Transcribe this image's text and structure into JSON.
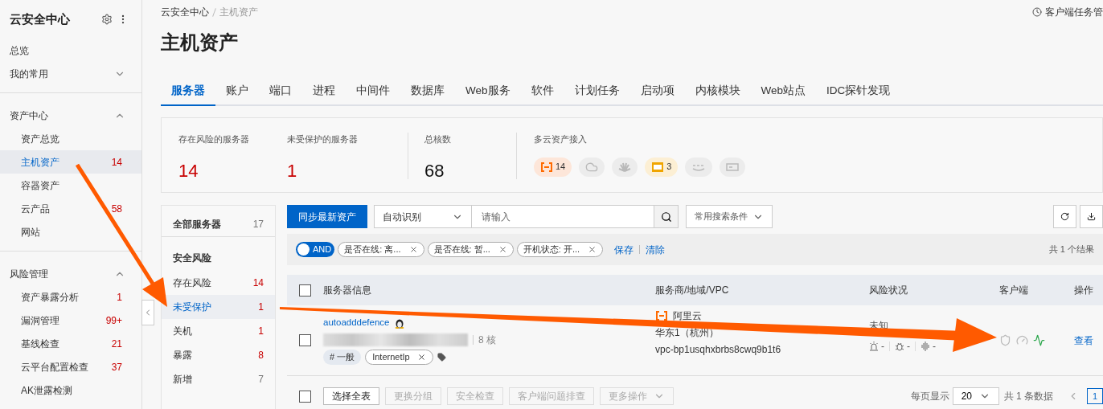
{
  "sidebar": {
    "title": "云安全中心",
    "groups": [
      {
        "label": "总览",
        "kind": "link"
      },
      {
        "label": "我的常用",
        "kind": "group",
        "expanded": false
      },
      {
        "label": "资产中心",
        "kind": "group",
        "expanded": true,
        "items": [
          {
            "label": "资产总览",
            "selected": false
          },
          {
            "label": "主机资产",
            "count": "14",
            "selected": true
          },
          {
            "label": "容器资产",
            "selected": false
          },
          {
            "label": "云产品",
            "count": "58",
            "selected": false
          },
          {
            "label": "网站",
            "selected": false
          }
        ]
      },
      {
        "label": "风险管理",
        "kind": "group",
        "expanded": true,
        "items": [
          {
            "label": "资产暴露分析",
            "count": "1",
            "selected": false
          },
          {
            "label": "漏洞管理",
            "count": "99+",
            "selected": false
          },
          {
            "label": "基线检查",
            "count": "21",
            "selected": false
          },
          {
            "label": "云平台配置检查",
            "count": "37",
            "selected": false
          },
          {
            "label": "AK泄露检测",
            "selected": false
          }
        ]
      }
    ]
  },
  "breadcrumb": [
    "云安全中心",
    "主机资产"
  ],
  "task_link": "客户端任务管",
  "page_title": "主机资产",
  "tabs": [
    {
      "label": "服务器",
      "selected": true
    },
    {
      "label": "账户",
      "selected": false
    },
    {
      "label": "端口",
      "selected": false
    },
    {
      "label": "进程",
      "selected": false
    },
    {
      "label": "中间件",
      "selected": false
    },
    {
      "label": "数据库",
      "selected": false
    },
    {
      "label": "Web服务",
      "selected": false
    },
    {
      "label": "软件",
      "selected": false
    },
    {
      "label": "计划任务",
      "selected": false
    },
    {
      "label": "启动项",
      "selected": false
    },
    {
      "label": "内核模块",
      "selected": false
    },
    {
      "label": "Web站点",
      "selected": false
    },
    {
      "label": "IDC探针发现",
      "selected": false
    }
  ],
  "stats": [
    {
      "label": "存在风险的服务器",
      "value": "14",
      "alert": true
    },
    {
      "label": "未受保护的服务器",
      "value": "1",
      "alert": true
    },
    {
      "label": "总核数",
      "value": "68",
      "alert": false
    }
  ],
  "multicloud": {
    "label": "多云资产接入",
    "providers": [
      {
        "kind": "aliyun",
        "count": "14",
        "active": true
      },
      {
        "kind": "cloud",
        "active": false
      },
      {
        "kind": "huawei",
        "active": false
      },
      {
        "kind": "idc",
        "count": "3",
        "active": true
      },
      {
        "kind": "aws",
        "active": false
      },
      {
        "kind": "other",
        "active": false
      }
    ]
  },
  "filter_list": [
    {
      "label": "全部服务器",
      "count": "17",
      "kind": "total",
      "selected": false,
      "alert": false
    },
    {
      "label": "安全风险",
      "kind": "heading",
      "selected": false
    },
    {
      "label": "存在风险",
      "count": "14",
      "kind": "item",
      "selected": false,
      "alert": true
    },
    {
      "label": "未受保护",
      "count": "1",
      "kind": "item",
      "selected": true,
      "alert": true
    },
    {
      "label": "关机",
      "count": "1",
      "kind": "item",
      "selected": false,
      "alert": true
    },
    {
      "label": "暴露",
      "count": "8",
      "kind": "item",
      "selected": false,
      "alert": true
    },
    {
      "label": "新增",
      "count": "7",
      "kind": "item",
      "selected": false,
      "alert": false
    }
  ],
  "toolbar": {
    "sync_button": "同步最新资产",
    "mode": "自动识别",
    "search_placeholder": "请输入",
    "saved_search": "常用搜索条件"
  },
  "filters": {
    "logic": {
      "label": "AND"
    },
    "chips": [
      "是否在线: 离...",
      "是否在线: 暂...",
      "开机状态: 开..."
    ],
    "actions": [
      "保存",
      "清除"
    ],
    "result": "共 1 个结果"
  },
  "table": {
    "all_checked": false,
    "columns": [
      "服务器信息",
      "服务商/地域/VPC",
      "风险状况",
      "客户端",
      "操作"
    ],
    "rows": [
      {
        "checked": false,
        "name": "autoadddefence",
        "cores": "8 核",
        "tags": [
          {
            "label": "# 一般",
            "kind": "group"
          },
          {
            "label": "InternetIp",
            "kind": "tag"
          }
        ],
        "provider": "阿里云",
        "region": "华东1（杭州）",
        "vpc": "vpc-bp1usqhxbrbs8cwq9b1t6",
        "risk": "未知",
        "risk_counts": [
          "-",
          "-",
          "-"
        ],
        "clients": [
          {
            "kind": "shield",
            "on": false
          },
          {
            "kind": "gauge",
            "on": false
          },
          {
            "kind": "monitor",
            "on": true
          }
        ],
        "action": "查看"
      }
    ]
  },
  "footer": {
    "checked": false,
    "buttons": [
      {
        "label": "选择全表",
        "disabled": false,
        "dropdown": false
      },
      {
        "label": "更换分组",
        "disabled": true,
        "dropdown": false
      },
      {
        "label": "安全检查",
        "disabled": true,
        "dropdown": false
      },
      {
        "label": "客户端问题排查",
        "disabled": true,
        "dropdown": false
      },
      {
        "label": "更多操作",
        "disabled": true,
        "dropdown": true
      }
    ],
    "page_size_label": "每页显示",
    "page_size": "20",
    "total": "共 1 条数据",
    "pages": [
      {
        "label": "1",
        "selected": true
      }
    ]
  }
}
